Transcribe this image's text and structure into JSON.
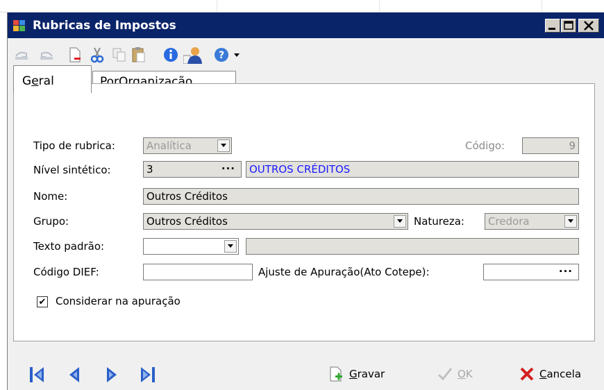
{
  "window": {
    "title": "Rubricas de Impostos",
    "min_label": "_",
    "max_label": "□",
    "close_label": "X"
  },
  "tabs": [
    {
      "label_pre": "G",
      "label_u": "e",
      "label_post": "ral"
    },
    {
      "label_pre": "Po",
      "label_u": "r",
      "label_post": " Organização"
    }
  ],
  "form": {
    "tipo_label": "Tipo de rubrica:",
    "tipo_value": "Analítica",
    "codigo_label": "Código:",
    "codigo_value": "9",
    "nivel_label": "Nível sintético:",
    "nivel_value": "3",
    "nivel_desc": "OUTROS CRÉDITOS",
    "nome_label": "Nome:",
    "nome_value": "Outros Créditos",
    "grupo_label": "Grupo:",
    "grupo_value": "Outros Créditos",
    "natureza_label": "Natureza:",
    "natureza_value": "Credora",
    "texto_label": "Texto padrão:",
    "texto_value": "",
    "texto_desc": "",
    "dief_label": "Código DIEF:",
    "dief_value": "",
    "ajuste_label": "Ajuste de Apuração(Ato Cotepe):",
    "ajuste_value": "",
    "dots": "···",
    "considerar_label": "Considerar na apuração",
    "considerar_checked": "✔"
  },
  "footer": {
    "gravar_u": "G",
    "gravar_rest": "ravar",
    "ok_u": "O",
    "ok_rest": "K",
    "cancela_u": "C",
    "cancela_rest": "ancela"
  },
  "colors": {
    "titlebar": "#0a246a",
    "nivel_desc_text": "#1a1aff",
    "nav_blue": "#2a5fc8",
    "cancel_red": "#d42020"
  }
}
